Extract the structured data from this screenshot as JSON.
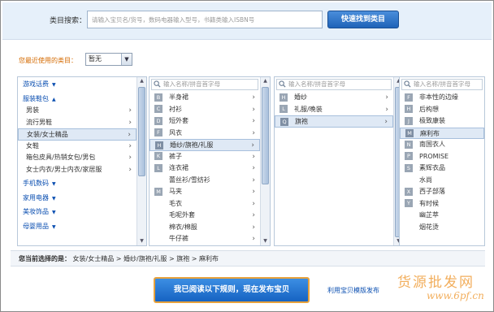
{
  "search": {
    "label": "类目搜索：",
    "placeholder": "请输入宝贝名/货号，数码电器输入型号，书籍类输入ISBN号",
    "button": "快速找到类目"
  },
  "recent": {
    "label": "您最近使用的类目：",
    "value": "暂无"
  },
  "col1": {
    "items": [
      {
        "label": "游戏话费",
        "type": "group"
      },
      {
        "label": "服装鞋包",
        "type": "group"
      },
      {
        "label": "男装",
        "type": "sub"
      },
      {
        "label": "流行男鞋",
        "type": "sub"
      },
      {
        "label": "女装/女士精品",
        "type": "sub",
        "selected": true
      },
      {
        "label": "女鞋",
        "type": "sub"
      },
      {
        "label": "箱包皮具/热销女包/男包",
        "type": "sub"
      },
      {
        "label": "女士内衣/男士内衣/家居服",
        "type": "sub"
      },
      {
        "label": "手机数码",
        "type": "group"
      },
      {
        "label": "家用电器",
        "type": "group"
      },
      {
        "label": "美妆饰品",
        "type": "group"
      },
      {
        "label": "母婴用品",
        "type": "group"
      }
    ]
  },
  "col2": {
    "filter_placeholder": "输入名称/拼音首字母",
    "items": [
      {
        "letter": "B",
        "label": "半身裙"
      },
      {
        "letter": "C",
        "label": "衬衫"
      },
      {
        "letter": "D",
        "label": "短外套"
      },
      {
        "letter": "F",
        "label": "风衣"
      },
      {
        "letter": "H",
        "label": "婚纱/旗袍/礼服",
        "selected": true
      },
      {
        "letter": "K",
        "label": "裤子"
      },
      {
        "letter": "L",
        "label": "连衣裙"
      },
      {
        "letter": "",
        "label": "蕾丝衫/雪纺衫"
      },
      {
        "letter": "M",
        "label": "马夹"
      },
      {
        "letter": "",
        "label": "毛衣"
      },
      {
        "letter": "",
        "label": "毛呢外套"
      },
      {
        "letter": "",
        "label": "棉衣/棉服"
      },
      {
        "letter": "",
        "label": "牛仔裤"
      }
    ]
  },
  "col3": {
    "filter_placeholder": "输入名称/拼音首字母",
    "items": [
      {
        "letter": "H",
        "label": "婚纱"
      },
      {
        "letter": "L",
        "label": "礼服/晚装"
      },
      {
        "letter": "Q",
        "label": "旗袍",
        "selected": true
      }
    ]
  },
  "col4": {
    "filter_placeholder": "输入名称/拼音首字母",
    "items": [
      {
        "letter": "F",
        "label": "非本性的边缘"
      },
      {
        "letter": "H",
        "label": "后构想"
      },
      {
        "letter": "J",
        "label": "极致康装"
      },
      {
        "letter": "M",
        "label": "麻利布",
        "selected": true
      },
      {
        "letter": "N",
        "label": "南国衣人"
      },
      {
        "letter": "P",
        "label": "PROMISE"
      },
      {
        "letter": "S",
        "label": "素辉衣品"
      },
      {
        "letter": "",
        "label": "水尚"
      },
      {
        "letter": "X",
        "label": "西子部落"
      },
      {
        "letter": "Y",
        "label": "有时候"
      },
      {
        "letter": "",
        "label": "幽芷萃"
      },
      {
        "letter": "",
        "label": "烟花烫"
      }
    ]
  },
  "path": {
    "label": "您当前选择的是：",
    "value": "女装/女士精品 > 婚纱/旗袍/礼服 > 旗袍 > 麻利布"
  },
  "publish_button": "我已阅读以下规则，现在发布宝贝",
  "template_link": "利用宝贝模版发布",
  "watermark": {
    "title": "货源批发网",
    "url": "www.6pf.cn"
  }
}
